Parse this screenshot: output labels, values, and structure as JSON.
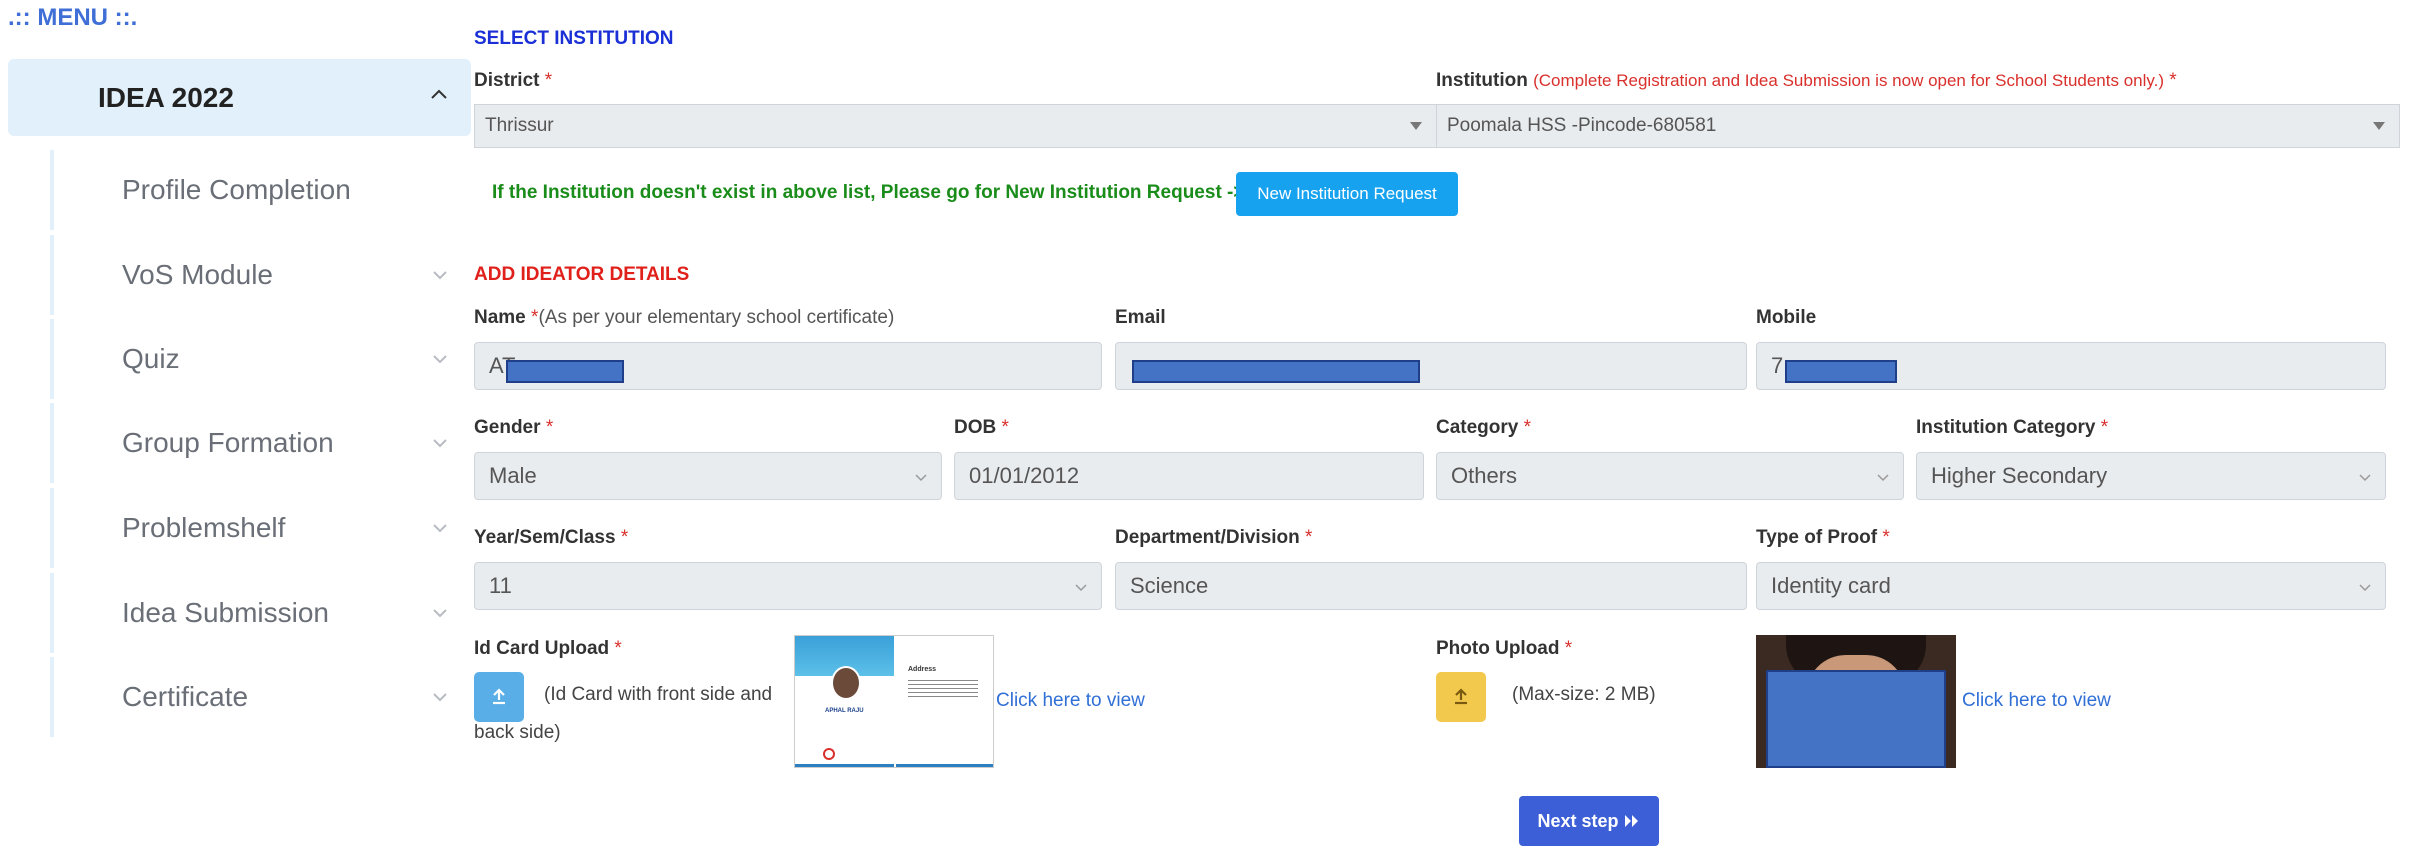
{
  "sidebar": {
    "menu_title": ".:: MENU ::.",
    "active_section": "IDEA 2022",
    "items": [
      {
        "label": "Profile Completion"
      },
      {
        "label": "VoS Module"
      },
      {
        "label": "Quiz"
      },
      {
        "label": "Group Formation"
      },
      {
        "label": "Problemshelf"
      },
      {
        "label": "Idea Submission"
      },
      {
        "label": "Certificate"
      }
    ]
  },
  "institution": {
    "section_title": "SELECT INSTITUTION",
    "district_label": "District",
    "district_value": "Thrissur",
    "institution_label": "Institution",
    "institution_note": "(Complete Registration and Idea Submission is now open for School Students only.)",
    "institution_value": "Poomala HSS -Pincode-680581",
    "missing_note": "If the Institution doesn't exist in above list, Please go for New Institution Request ->",
    "new_request_button": "New Institution Request"
  },
  "ideator": {
    "section_title": "ADD IDEATOR DETAILS",
    "name_label": "Name",
    "name_hint": "(As per your elementary school certificate)",
    "name_value": "AT",
    "email_label": "Email",
    "email_value": "",
    "mobile_label": "Mobile",
    "mobile_value": "7",
    "gender_label": "Gender",
    "gender_value": "Male",
    "dob_label": "DOB",
    "dob_value": "01/01/2012",
    "category_label": "Category",
    "category_value": "Others",
    "inst_category_label": "Institution Category",
    "inst_category_value": "Higher Secondary",
    "class_label": "Year/Sem/Class",
    "class_value": "11",
    "department_label": "Department/Division",
    "department_value": "Science",
    "proof_label": "Type of Proof",
    "proof_value": "Identity card",
    "idcard_label": "Id Card Upload",
    "idcard_hint_line1": "(Id Card with front side and",
    "idcard_hint_line2": "back side)",
    "idcard_view_link": "Click here to view",
    "photo_label": "Photo Upload",
    "photo_hint": "(Max-size: 2 MB)",
    "photo_view_link": "Click here to view",
    "required_mark": "*",
    "next_button": "Next step"
  },
  "id_card_preview": {
    "name": "APHAL RAJU",
    "address_heading": "Address"
  },
  "colors": {
    "accent": "#17a2f0",
    "primary": "#3c5ed6",
    "danger": "#d9302c",
    "success": "#1a8c1a",
    "sidebar_active": "#e1f0fb",
    "warning": "#f2c94c",
    "redaction": "#4472c4"
  },
  "icons": {
    "collapse": "chevron-up-icon",
    "expand": "chevron-down-icon",
    "upload": "upload-icon",
    "next": "double-chevron-right-icon"
  }
}
